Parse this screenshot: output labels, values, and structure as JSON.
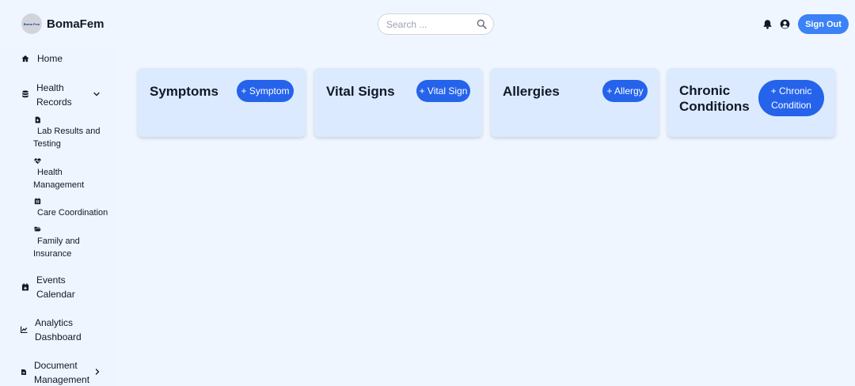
{
  "header": {
    "brand_name": "BomaFem",
    "logo_text": "Boma Fem",
    "search_placeholder": "Search ...",
    "signout_label": "Sign Out"
  },
  "sidebar": {
    "home": "Home",
    "health_records": {
      "line1": "Health",
      "line2": "Records"
    },
    "sub_items": {
      "lab": {
        "line1": "Lab Results and",
        "line2": "Testing"
      },
      "health_mgmt": {
        "line1": "Health",
        "line2": "Management"
      },
      "care": {
        "line1": "Care Coordination"
      },
      "family": {
        "line1": "Family and",
        "line2": "Insurance"
      }
    },
    "events": {
      "line1": "Events",
      "line2": "Calendar"
    },
    "analytics": {
      "line1": "Analytics",
      "line2": "Dashboard"
    },
    "documents": {
      "line1": "Document",
      "line2": "Management"
    }
  },
  "cards": {
    "symptoms": {
      "title": "Symptoms",
      "button": "+ Symptom"
    },
    "vitals": {
      "title": "Vital Signs",
      "button": "+ Vital Sign"
    },
    "allergies": {
      "title": "Allergies",
      "button": "+ Allergy"
    },
    "chronic": {
      "title_line1": "Chronic",
      "title_line2": "Conditions",
      "button_line1": "+ Chronic",
      "button_line2": "Condition"
    }
  },
  "colors": {
    "background": "#eff6ff",
    "card": "#dbeafe",
    "primary_button": "#2563eb",
    "signout_button": "#3b82f6"
  },
  "icons": {
    "search": "search-icon",
    "bell": "bell-icon",
    "user": "user-circle-icon",
    "home": "home-icon",
    "database": "database-icon",
    "chevron": "chevron-down-icon"
  }
}
